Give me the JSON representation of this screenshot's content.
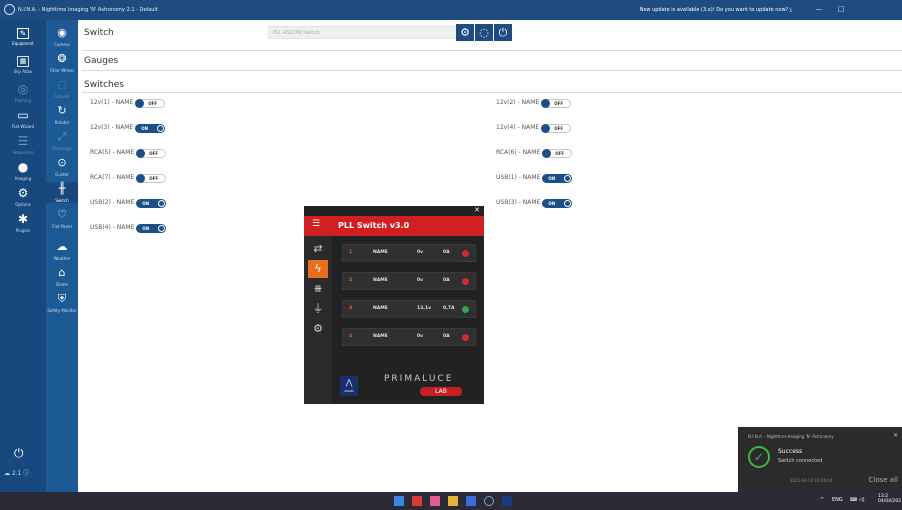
{
  "window": {
    "title": "N.I.N.A. - Nighttime Imaging 'N' Astronomy 2.1 - Default",
    "update_notice": "New update is available (3.x)! Do you want to update now? ⤓",
    "min_icon": "minimize-icon",
    "max_icon": "maximize-icon"
  },
  "leftnav": {
    "items": [
      {
        "label": "Equipment",
        "icon": "camera-rig-icon"
      },
      {
        "label": "Sky Atlas",
        "icon": "map-icon"
      },
      {
        "label": "Framing",
        "icon": "framing-icon"
      },
      {
        "label": "Flat Wizard",
        "icon": "flat-icon"
      },
      {
        "label": "Sequencer",
        "icon": "sequence-icon"
      },
      {
        "label": "Imaging",
        "icon": "imaging-icon"
      },
      {
        "label": "Options",
        "icon": "options-icon"
      },
      {
        "label": "Plugins",
        "icon": "plugin-icon"
      }
    ],
    "bottom_version": "2.1"
  },
  "subnav": {
    "items": [
      "Camera",
      "Filter Wheel",
      "Focuser",
      "Rotator",
      "Telescope",
      "Guider",
      "Switch",
      "Flat Panel",
      "Weather",
      "Dome",
      "Safety Monitor"
    ]
  },
  "device": {
    "title": "Switch",
    "selected": "PLL ASCOM Switch"
  },
  "sections": {
    "gauges": "Gauges",
    "switches": "Switches"
  },
  "switches": {
    "left": [
      {
        "label": "12v(1) - NAME",
        "state": "OFF"
      },
      {
        "label": "12v(3) - NAME",
        "state": "ON"
      },
      {
        "label": "RCA(5) - NAME",
        "state": "OFF"
      },
      {
        "label": "RCA(7) - NAME",
        "state": "OFF"
      },
      {
        "label": "USB(2) - NAME",
        "state": "ON"
      },
      {
        "label": "USB(4) - NAME",
        "state": "ON"
      }
    ],
    "right": [
      {
        "label": "12v(2) - NAME",
        "state": "OFF"
      },
      {
        "label": "12v(4) - NAME",
        "state": "OFF"
      },
      {
        "label": "RCA(6) - NAME",
        "state": "OFF"
      },
      {
        "label": "USB(1) - NAME",
        "state": "ON"
      },
      {
        "label": "USB(3) - NAME",
        "state": "ON"
      }
    ]
  },
  "pll": {
    "title": "PLL Switch v3.0",
    "rows": [
      {
        "num": "1",
        "name": "NAME",
        "v": "0v",
        "a": "0A",
        "color": "#d22b2b"
      },
      {
        "num": "2",
        "name": "NAME",
        "v": "0v",
        "a": "0A",
        "color": "#d22b2b"
      },
      {
        "num": "3",
        "name": "NAME",
        "v": "13,1v",
        "a": "0,7A",
        "color": "#2fa84f"
      },
      {
        "num": "4",
        "name": "NAME",
        "v": "0v",
        "a": "0A",
        "color": "#d22b2b"
      }
    ],
    "brand": "PRIMALUCE",
    "brand_sub": "LAB",
    "ascom": "ASCOM"
  },
  "toast": {
    "app": "N.I.N.A. - Nighttime Imaging 'N' Astronomy",
    "title": "Success",
    "message": "Switch connected",
    "time": "2025-04-04 16:26:44",
    "close": "Close all"
  },
  "taskbar": {
    "lang": "ENG",
    "time": "13:2",
    "date": "04/04/202"
  },
  "colors": {
    "accent": "#1f4c80",
    "pll_red": "#d02022",
    "orange": "#e86d1e"
  }
}
